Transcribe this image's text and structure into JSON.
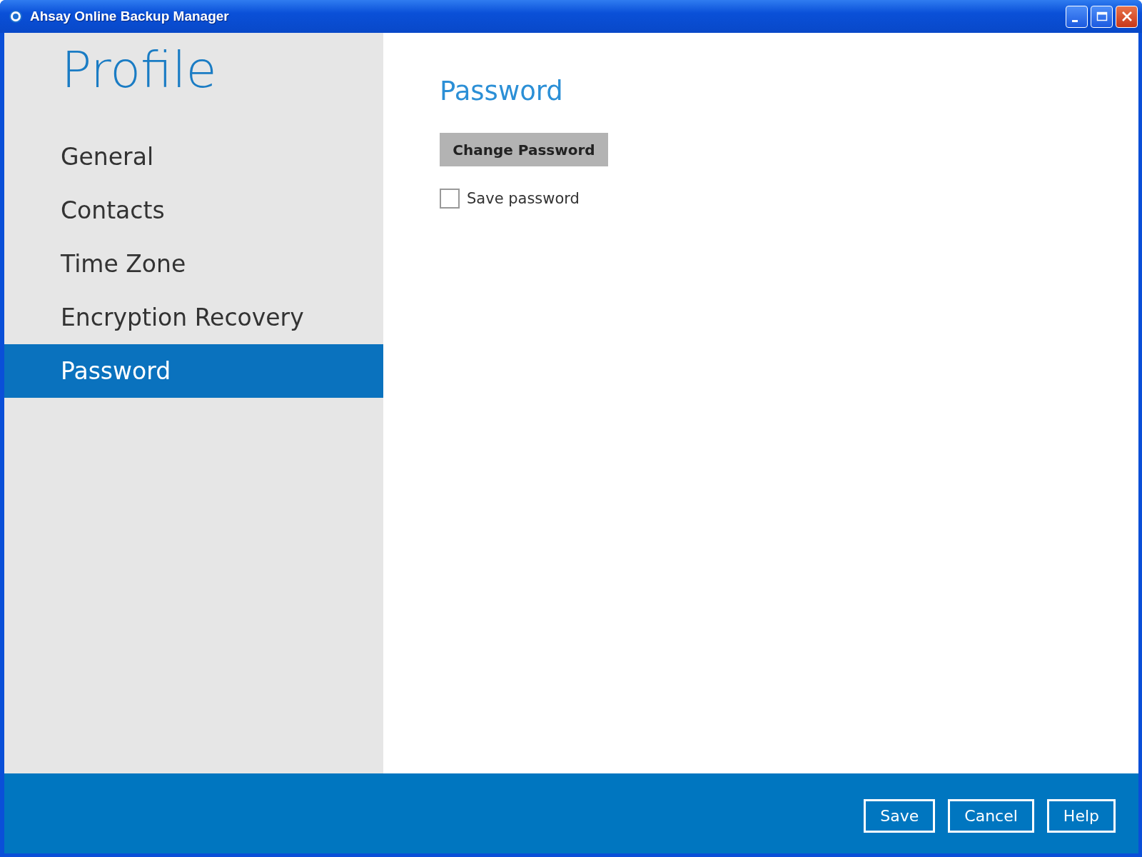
{
  "window": {
    "title": "Ahsay Online Backup Manager"
  },
  "sidebar": {
    "title": "Profile",
    "items": [
      {
        "label": "General",
        "selected": false
      },
      {
        "label": "Contacts",
        "selected": false
      },
      {
        "label": "Time Zone",
        "selected": false
      },
      {
        "label": "Encryption Recovery",
        "selected": false
      },
      {
        "label": "Password",
        "selected": true
      }
    ]
  },
  "content": {
    "heading": "Password",
    "change_button": "Change Password",
    "save_password": {
      "label": "Save password",
      "checked": false
    }
  },
  "footer": {
    "buttons": [
      "Save",
      "Cancel",
      "Help"
    ]
  }
}
